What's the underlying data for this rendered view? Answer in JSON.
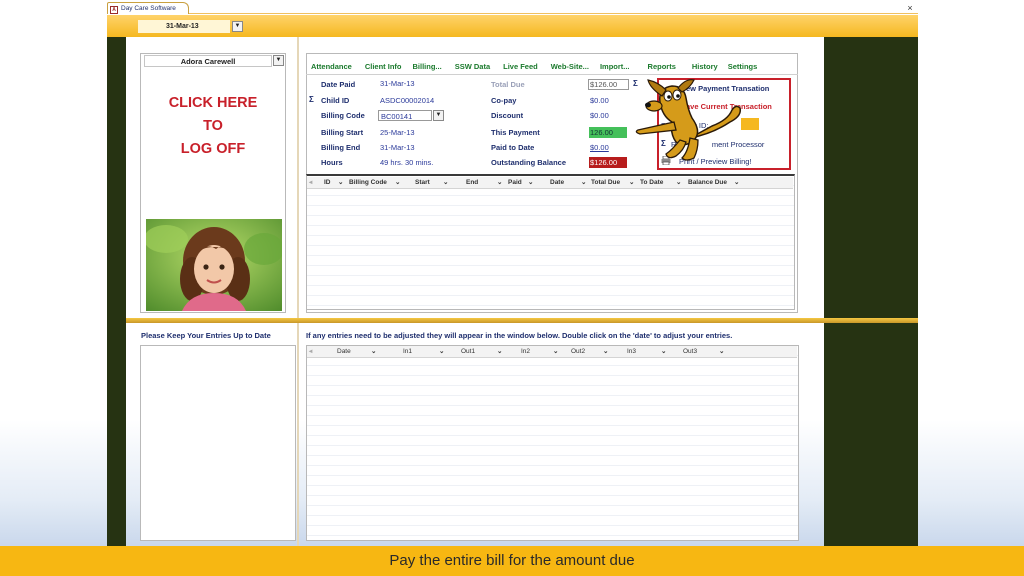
{
  "window": {
    "app_title": "Day Care Software",
    "close_glyph": "×"
  },
  "toolbar": {
    "date_value": "31-Mar-13",
    "dropdown_glyph": "▼"
  },
  "user": {
    "name": "Adora Carewell",
    "logoff_line1": "CLICK HERE",
    "logoff_line2": "TO",
    "logoff_line3": "LOG OFF"
  },
  "nav": {
    "items": [
      "Attendance",
      "Client Info",
      "Billing...",
      "SSW Data",
      "Live Feed",
      "Web-Site...",
      "Import...",
      "Reports",
      "History",
      "Settings"
    ]
  },
  "billing": {
    "date_paid_label": "Date Paid",
    "date_paid": "31-Mar-13",
    "child_id_label": "Child ID",
    "child_id": "ASDC00002014",
    "billing_code_label": "Billing Code",
    "billing_code": "BC00141",
    "billing_start_label": "Billing Start",
    "billing_start": "25-Mar-13",
    "billing_end_label": "Billing End",
    "billing_end": "31-Mar-13",
    "hours_label": "Hours",
    "hours": "49 hrs. 30 mins.",
    "total_due_label": "Total Due",
    "total_due": "$126.00",
    "copay_label": "Co-pay",
    "copay": "$0.00",
    "discount_label": "Discount",
    "discount": "$0.00",
    "this_payment_label": "This Payment",
    "this_payment": "126.00",
    "paid_to_date_label": "Paid to Date",
    "paid_to_date": "$0.00",
    "outstanding_label": "Outstanding Balance",
    "outstanding": "$126.00",
    "sigma": "Σ"
  },
  "actions": {
    "new_payment": "ew Payment Transation",
    "save_current": "ave Current Transaction",
    "payment_id_label": "Pay        ot ID:",
    "run_processor": "Run             ment Processor",
    "print_preview": "Print / Preview Billing!"
  },
  "grid1": {
    "columns": [
      "ID",
      "Billing Code",
      "Start",
      "End",
      "Paid",
      "Date",
      "Total Due",
      "To Date",
      "Balance Due"
    ]
  },
  "lower": {
    "keep_label": "Please Keep Your Entries Up to Date",
    "adjust_label": "If any entries need to be adjusted they will appear in the window below. Double click on the 'date' to adjust your entries."
  },
  "grid2": {
    "columns": [
      "Date",
      "In1",
      "Out1",
      "In2",
      "Out2",
      "In3",
      "Out3"
    ]
  },
  "footer": {
    "caption": "Pay the entire bill for the amount due"
  },
  "colors": {
    "gold": "#f5b820",
    "dark_side": "#263312",
    "logoff_red": "#c8202a",
    "nav_green": "#1b7a2d",
    "payment_green": "#44c05a",
    "balance_red": "#b71d1d"
  }
}
